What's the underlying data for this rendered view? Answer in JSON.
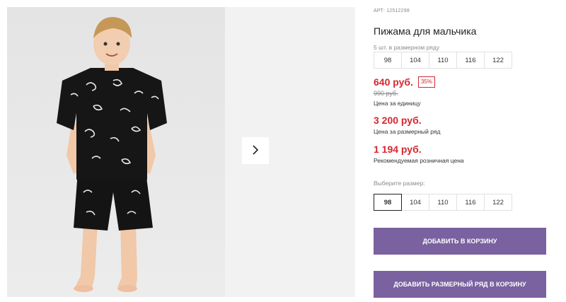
{
  "product": {
    "article": "АРТ: 12512298",
    "title": "Пижама для мальчика",
    "pack_label": "5 шт. в размерном ряду",
    "pack_sizes": [
      "98",
      "104",
      "110",
      "116",
      "122"
    ],
    "price": "640 руб.",
    "discount": "35%",
    "old_price": "990 руб.",
    "unit_price_label": "Цена за единицу",
    "pack_price": "3 200 руб.",
    "pack_price_label": "Цена за размерный ряд",
    "rrp": "1 194 руб.",
    "rrp_label": "Рекомендуемая розничная цена",
    "select_size_label": "Выберите размер:",
    "sizes": [
      "98",
      "104",
      "110",
      "116",
      "122"
    ],
    "selected_size": "98"
  },
  "actions": {
    "add_to_cart": "Добавить в корзину",
    "add_pack_to_cart": "Добавить размерный ряд в корзину"
  },
  "colors": {
    "accent": "#7a619f",
    "price": "#d6262e"
  },
  "icons": {
    "gallery_next": "chevron-right-icon"
  }
}
